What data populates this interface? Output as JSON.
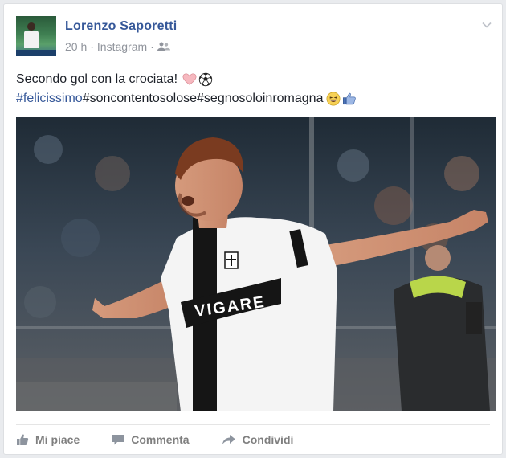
{
  "post": {
    "author": "Lorenzo Saporetti",
    "time": "20 h",
    "source": "Instagram",
    "separator": "·",
    "line1": "Secondo gol con la crociata!",
    "hashtags": [
      "#felicissimo",
      "#soncontentosolose",
      "#segnosoloinromagna"
    ],
    "sponsor_text": "VIGARE"
  },
  "actions": {
    "like": "Mi piace",
    "comment": "Commenta",
    "share": "Condividi"
  },
  "colors": {
    "link": "#365899",
    "muted": "#90949c",
    "action": "#7f7f7f"
  },
  "icons": [
    "friends-icon",
    "chevron-down-icon",
    "heart-icon",
    "soccer-ball-icon",
    "grinning-face-icon",
    "thumbs-up-icon",
    "like-icon",
    "comment-icon",
    "share-icon"
  ]
}
